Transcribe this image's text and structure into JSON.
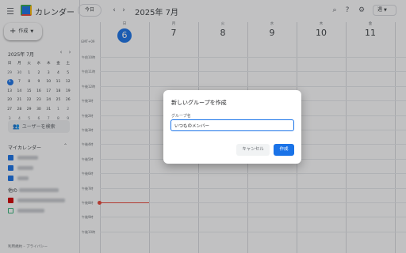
{
  "header": {
    "app_title": "カレンダー",
    "today_label": "今日",
    "date_title": "2025年 7月",
    "view_label": "週",
    "icons": [
      "menu-icon",
      "search-icon",
      "help-icon",
      "settings-icon"
    ]
  },
  "sidebar": {
    "create_label": "作成",
    "mini_cal": {
      "title": "2025年 7月",
      "weekdays": [
        "日",
        "月",
        "火",
        "水",
        "木",
        "金",
        "土"
      ],
      "weeks": [
        [
          "29",
          "30",
          "1",
          "2",
          "3",
          "4",
          "5"
        ],
        [
          "6",
          "7",
          "8",
          "9",
          "10",
          "11",
          "12"
        ],
        [
          "13",
          "14",
          "15",
          "16",
          "17",
          "18",
          "19"
        ],
        [
          "20",
          "21",
          "22",
          "23",
          "24",
          "25",
          "26"
        ],
        [
          "27",
          "28",
          "29",
          "30",
          "31",
          "1",
          "2"
        ],
        [
          "3",
          "4",
          "5",
          "6",
          "7",
          "8",
          "9"
        ]
      ]
    },
    "people_search": "ユーザーを検索",
    "my_calendars_title": "マイカレンダー",
    "other_calendars_title": "他の"
  },
  "week": {
    "tz": "GMT+09",
    "days": [
      {
        "dow": "日",
        "num": "6"
      },
      {
        "dow": "月",
        "num": "7"
      },
      {
        "dow": "火",
        "num": "8"
      },
      {
        "dow": "水",
        "num": "9"
      },
      {
        "dow": "木",
        "num": "10"
      },
      {
        "dow": "金",
        "num": "11"
      }
    ],
    "times": [
      "午前10時",
      "午前11時",
      "午後12時",
      "午後1時",
      "午後2時",
      "午後3時",
      "午後4時",
      "午後5時",
      "午後6時",
      "午後7時",
      "午後8時",
      "午後9時",
      "午後10時"
    ]
  },
  "footer": "利用規約 – プライバシー",
  "dialog": {
    "title": "新しいグループを作成",
    "label": "グループ名",
    "value": "いつものメンバー",
    "cancel": "キャンセル",
    "create": "作成"
  },
  "colors": {
    "accent": "#1a73e8",
    "now_line": "#ea4335",
    "overlay": "rgba(32,33,36,0.28)"
  }
}
